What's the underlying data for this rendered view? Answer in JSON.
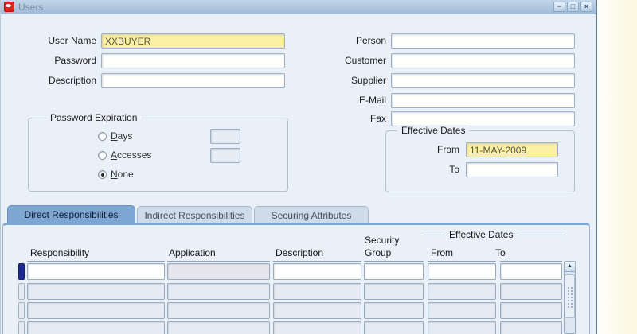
{
  "window": {
    "title": "Users",
    "icons": {
      "minimize": "−",
      "maximize": "□",
      "close": "×",
      "scroll_up": "▲"
    }
  },
  "form": {
    "left_fields": [
      {
        "label": "User Name",
        "value": "XXBUYER",
        "highlight": true
      },
      {
        "label": "Password",
        "value": "",
        "highlight": false
      },
      {
        "label": "Description",
        "value": "",
        "highlight": false
      }
    ],
    "right_fields": [
      {
        "label": "Person",
        "value": ""
      },
      {
        "label": "Customer",
        "value": ""
      },
      {
        "label": "Supplier",
        "value": ""
      },
      {
        "label": "E-Mail",
        "value": ""
      },
      {
        "label": "Fax",
        "value": ""
      }
    ],
    "password_expiration": {
      "legend": "Password Expiration",
      "options": [
        {
          "mnemonic": "D",
          "rest": "ays",
          "selected": false,
          "input_value": ""
        },
        {
          "mnemonic": "A",
          "rest": "ccesses",
          "selected": false,
          "input_value": ""
        },
        {
          "mnemonic": "N",
          "rest": "one",
          "selected": true
        }
      ]
    },
    "effective_dates": {
      "legend": "Effective Dates",
      "from_label": "From",
      "from_value": "11-MAY-2009",
      "from_highlight": true,
      "to_label": "To",
      "to_value": ""
    }
  },
  "tabs": [
    {
      "label": "Direct Responsibilities",
      "active": true
    },
    {
      "label": "Indirect Responsibilities",
      "active": false
    },
    {
      "label": "Securing Attributes",
      "active": false
    }
  ],
  "responsibilities_table": {
    "header_groups": {
      "security_line1": "Security",
      "security_line2": "Group",
      "effective_dates": "Effective Dates"
    },
    "columns": [
      "Responsibility",
      "Application",
      "Description",
      "Group",
      "From",
      "To"
    ],
    "rows": [
      {
        "current": true,
        "responsibility": "",
        "application": "",
        "description": "",
        "security_group": "",
        "from": "",
        "to": ""
      },
      {
        "current": false,
        "responsibility": "",
        "application": "",
        "description": "",
        "security_group": "",
        "from": "",
        "to": ""
      },
      {
        "current": false,
        "responsibility": "",
        "application": "",
        "description": "",
        "security_group": "",
        "from": "",
        "to": ""
      },
      {
        "current": false,
        "responsibility": "",
        "application": "",
        "description": "",
        "security_group": "",
        "from": "",
        "to": ""
      }
    ]
  },
  "colors": {
    "titlebar": "#aac4de",
    "window_bg": "#eaf0f8",
    "highlight_field": "#fdf0a2",
    "active_tab": "#7ea6d2",
    "inactive_tab": "#cfdbe9",
    "record_indicator": "#1b2a8c",
    "oracle_red": "#e2231a"
  }
}
